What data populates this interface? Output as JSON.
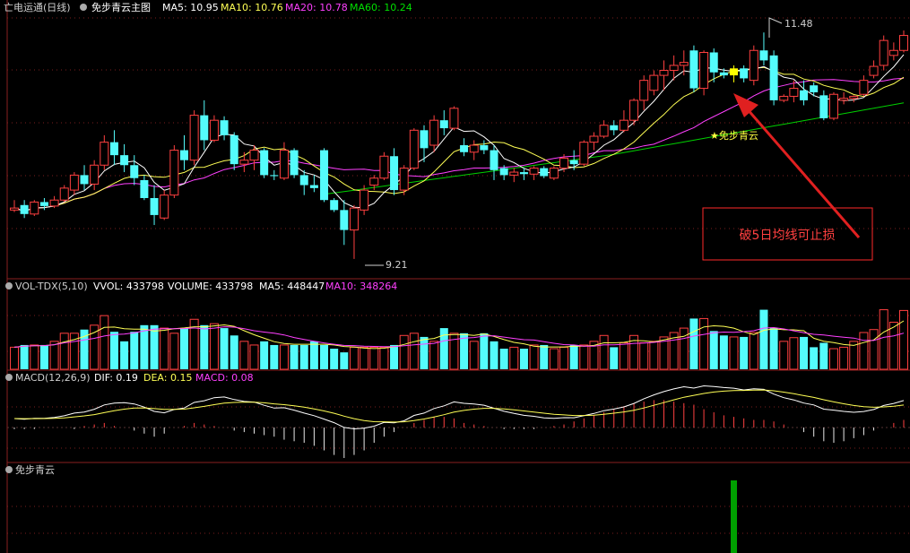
{
  "colors": {
    "bg": "#000000",
    "up": "#ff4040",
    "down": "#54fcfc",
    "ma5": "#ffffff",
    "ma10": "#ffff55",
    "ma20": "#ff40ff",
    "ma60": "#00d000",
    "grid": "#7a1e1e",
    "signal_bar": "#ffff00",
    "green_bar": "#00a000",
    "arrow": "#ff2a2a",
    "annotation_text": "#ff4040"
  },
  "main_panel": {
    "stock_name": "亡电运通(日线)",
    "indicator_name": "免步青云主图",
    "ma5_label": "MA5: 10.95",
    "ma10_label": "MA10: 10.76",
    "ma20_label": "MA20: 10.78",
    "ma60_label": "MA60: 10.24",
    "high_marker": "11.48",
    "low_marker": "9.21",
    "signal_label": "★免步青云",
    "annotation": "破5日均线可止损"
  },
  "volume_panel": {
    "title": "VOL-TDX(5,10)",
    "vvol_label": "VVOL: 433798",
    "volume_label": "VOLUME: 433798",
    "ma5_label": "MA5: 448447",
    "ma10_label": "MA10: 348264"
  },
  "macd_panel": {
    "title": "MACD(12,26,9)",
    "dif_label": "DIF: 0.19",
    "dea_label": "DEA: 0.15",
    "macd_label": "MACD: 0.08"
  },
  "signal_panel": {
    "title": "免步青云"
  },
  "chart_data": {
    "type": "candlestick",
    "candles": [
      [
        9.7,
        9.8,
        9.68,
        9.72
      ],
      [
        9.75,
        9.8,
        9.62,
        9.66
      ],
      [
        9.66,
        9.8,
        9.64,
        9.78
      ],
      [
        9.78,
        9.82,
        9.7,
        9.74
      ],
      [
        9.74,
        9.84,
        9.72,
        9.8
      ],
      [
        9.8,
        9.95,
        9.78,
        9.92
      ],
      [
        9.9,
        10.08,
        9.85,
        10.05
      ],
      [
        10.05,
        10.15,
        9.9,
        9.96
      ],
      [
        9.96,
        10.2,
        9.9,
        10.15
      ],
      [
        10.15,
        10.45,
        10.1,
        10.38
      ],
      [
        10.38,
        10.5,
        10.15,
        10.25
      ],
      [
        10.25,
        10.36,
        10.08,
        10.15
      ],
      [
        10.15,
        10.25,
        9.95,
        10.02
      ],
      [
        10.0,
        10.05,
        9.8,
        9.82
      ],
      [
        9.82,
        9.95,
        9.55,
        9.65
      ],
      [
        9.62,
        9.9,
        9.6,
        9.85
      ],
      [
        9.85,
        10.35,
        9.82,
        10.3
      ],
      [
        10.3,
        10.45,
        10.1,
        10.2
      ],
      [
        10.2,
        10.7,
        10.15,
        10.65
      ],
      [
        10.65,
        10.8,
        10.3,
        10.4
      ],
      [
        10.4,
        10.65,
        10.38,
        10.6
      ],
      [
        10.6,
        10.64,
        10.4,
        10.45
      ],
      [
        10.45,
        10.48,
        10.1,
        10.16
      ],
      [
        10.16,
        10.28,
        10.08,
        10.2
      ],
      [
        10.2,
        10.35,
        10.1,
        10.3
      ],
      [
        10.3,
        10.32,
        10.02,
        10.05
      ],
      [
        10.05,
        10.1,
        10.0,
        10.04
      ],
      [
        10.02,
        10.38,
        10.0,
        10.3
      ],
      [
        10.3,
        10.32,
        10.02,
        10.05
      ],
      [
        10.05,
        10.1,
        9.85,
        9.95
      ],
      [
        9.95,
        10.05,
        9.88,
        9.92
      ],
      [
        10.3,
        10.32,
        9.78,
        9.8
      ],
      [
        9.8,
        9.82,
        9.68,
        9.7
      ],
      [
        9.7,
        9.8,
        9.35,
        9.5
      ],
      [
        9.5,
        9.75,
        9.21,
        9.72
      ],
      [
        9.7,
        9.95,
        9.65,
        9.9
      ],
      [
        9.95,
        10.05,
        9.9,
        10.02
      ],
      [
        10.02,
        10.28,
        10.0,
        10.24
      ],
      [
        10.24,
        10.32,
        9.85,
        9.9
      ],
      [
        9.9,
        10.15,
        9.85,
        10.12
      ],
      [
        10.12,
        10.52,
        10.1,
        10.5
      ],
      [
        10.5,
        10.55,
        10.18,
        10.32
      ],
      [
        10.35,
        10.65,
        10.28,
        10.6
      ],
      [
        10.6,
        10.7,
        10.45,
        10.52
      ],
      [
        10.52,
        10.74,
        10.5,
        10.72
      ],
      [
        10.35,
        10.42,
        10.24,
        10.28
      ],
      [
        10.28,
        10.4,
        10.2,
        10.35
      ],
      [
        10.35,
        10.4,
        10.26,
        10.3
      ],
      [
        10.3,
        10.35,
        10.0,
        10.1
      ],
      [
        10.12,
        10.15,
        10.0,
        10.05
      ],
      [
        10.05,
        10.12,
        9.98,
        10.08
      ],
      [
        10.08,
        10.12,
        10.0,
        10.06
      ],
      [
        10.06,
        10.14,
        10.0,
        10.12
      ],
      [
        10.12,
        10.14,
        10.02,
        10.04
      ],
      [
        10.02,
        10.14,
        10.0,
        10.12
      ],
      [
        10.12,
        10.26,
        10.08,
        10.22
      ],
      [
        10.2,
        10.3,
        10.1,
        10.16
      ],
      [
        10.16,
        10.4,
        10.14,
        10.38
      ],
      [
        10.38,
        10.48,
        10.3,
        10.44
      ],
      [
        10.44,
        10.6,
        10.42,
        10.55
      ],
      [
        10.55,
        10.6,
        10.45,
        10.5
      ],
      [
        10.5,
        10.7,
        10.48,
        10.6
      ],
      [
        10.6,
        10.82,
        10.55,
        10.8
      ],
      [
        10.8,
        11.05,
        10.7,
        11.0
      ],
      [
        10.9,
        11.1,
        10.85,
        11.05
      ],
      [
        11.05,
        11.2,
        10.9,
        11.1
      ],
      [
        11.1,
        11.25,
        11.0,
        11.15
      ],
      [
        11.15,
        11.3,
        11.05,
        11.18
      ],
      [
        11.3,
        11.35,
        10.88,
        10.92
      ],
      [
        10.92,
        11.3,
        10.85,
        11.28
      ],
      [
        11.28,
        11.32,
        10.98,
        11.08
      ],
      [
        11.08,
        11.12,
        11.02,
        11.05
      ],
      [
        11.05,
        11.15,
        10.98,
        11.12
      ],
      [
        11.12,
        11.15,
        10.98,
        11.02
      ],
      [
        11.0,
        11.35,
        10.95,
        11.3
      ],
      [
        11.3,
        11.48,
        11.15,
        11.2
      ],
      [
        11.25,
        11.3,
        10.75,
        10.8
      ],
      [
        10.8,
        10.86,
        10.78,
        10.84
      ],
      [
        10.84,
        11.0,
        10.78,
        10.92
      ],
      [
        10.9,
        11.0,
        10.75,
        10.8
      ],
      [
        10.95,
        10.98,
        10.84,
        10.88
      ],
      [
        10.85,
        10.9,
        10.6,
        10.62
      ],
      [
        10.62,
        10.88,
        10.6,
        10.86
      ],
      [
        10.8,
        10.88,
        10.76,
        10.82
      ],
      [
        10.82,
        10.85,
        10.78,
        10.84
      ],
      [
        10.86,
        11.05,
        10.84,
        11.0
      ],
      [
        11.05,
        11.2,
        11.02,
        11.14
      ],
      [
        11.15,
        11.45,
        11.1,
        11.4
      ],
      [
        11.25,
        11.38,
        11.2,
        11.3
      ],
      [
        11.3,
        11.5,
        11.28,
        11.45
      ]
    ],
    "signal_candle_index": 72,
    "volumes": [
      0.3,
      0.33,
      0.33,
      0.33,
      0.38,
      0.49,
      0.49,
      0.54,
      0.6,
      0.73,
      0.51,
      0.38,
      0.51,
      0.6,
      0.6,
      0.56,
      0.49,
      0.56,
      0.68,
      0.6,
      0.62,
      0.56,
      0.46,
      0.38,
      0.33,
      0.38,
      0.33,
      0.33,
      0.33,
      0.33,
      0.38,
      0.33,
      0.28,
      0.23,
      0.3,
      0.3,
      0.3,
      0.3,
      0.33,
      0.46,
      0.49,
      0.44,
      0.38,
      0.56,
      0.49,
      0.49,
      0.38,
      0.49,
      0.38,
      0.28,
      0.3,
      0.28,
      0.33,
      0.33,
      0.28,
      0.3,
      0.33,
      0.33,
      0.38,
      0.46,
      0.3,
      0.36,
      0.46,
      0.36,
      0.38,
      0.44,
      0.5,
      0.56,
      0.69,
      0.69,
      0.52,
      0.46,
      0.44,
      0.44,
      0.5,
      0.81,
      0.56,
      0.38,
      0.43,
      0.44,
      0.3,
      0.36,
      0.28,
      0.3,
      0.38,
      0.5,
      0.54,
      0.81,
      0.64,
      0.8
    ],
    "macd_hist": [
      -0.01,
      -0.01,
      -0.01,
      0.0,
      0.0,
      0.0,
      -0.01,
      0.01,
      0.02,
      0.03,
      0.01,
      0.0,
      -0.02,
      -0.04,
      -0.06,
      -0.04,
      0.0,
      0.01,
      0.03,
      0.02,
      0.01,
      0.0,
      -0.02,
      -0.03,
      -0.04,
      -0.05,
      -0.06,
      -0.08,
      -0.09,
      -0.1,
      -0.12,
      -0.15,
      -0.18,
      -0.2,
      -0.18,
      -0.15,
      -0.1,
      -0.06,
      -0.03,
      0.0,
      0.03,
      0.05,
      0.07,
      0.07,
      0.06,
      0.03,
      0.02,
      0.01,
      0.0,
      -0.01,
      -0.01,
      -0.01,
      -0.01,
      0.0,
      0.01,
      0.02,
      0.04,
      0.06,
      0.08,
      0.1,
      0.12,
      0.14,
      0.16,
      0.17,
      0.18,
      0.18,
      0.17,
      0.16,
      0.15,
      0.12,
      0.1,
      0.08,
      0.07,
      0.06,
      0.05,
      0.05,
      0.04,
      0.02,
      0.0,
      -0.03,
      -0.06,
      -0.09,
      -0.1,
      -0.09,
      -0.07,
      -0.05,
      -0.02,
      0.0,
      0.03,
      0.05
    ],
    "signal_bar_index": 72
  }
}
